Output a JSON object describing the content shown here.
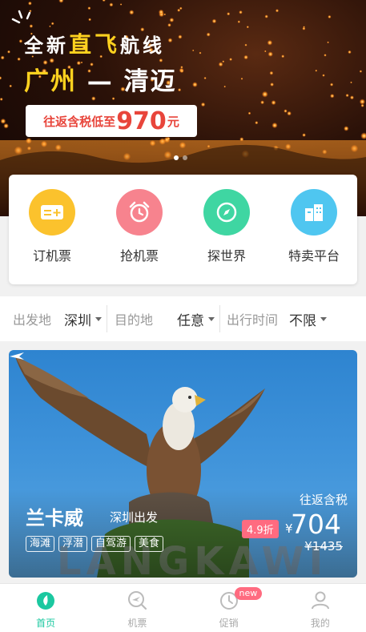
{
  "banner": {
    "line1_a": "全新",
    "line1_b": "直飞",
    "line1_c": "航线",
    "route_from": "广州",
    "route_dash": "—",
    "route_to": "清迈",
    "price_prefix": "往返含税低至",
    "price_value": "970",
    "price_unit": "元",
    "carousel_pages": 2,
    "carousel_active": 1
  },
  "quick_menu": [
    {
      "label": "订机票",
      "icon": "ticket-icon",
      "color": "#fbc22d"
    },
    {
      "label": "抢机票",
      "icon": "alarm-clock-icon",
      "color": "#f7838e"
    },
    {
      "label": "探世界",
      "icon": "compass-icon",
      "color": "#3fd6a2"
    },
    {
      "label": "特卖平台",
      "icon": "store-icon",
      "color": "#4fc6f0"
    }
  ],
  "filter": {
    "origin_label": "出发地",
    "origin_value": "深圳",
    "destination_label": "目的地",
    "destination_value": "任意",
    "time_label": "出行时间",
    "time_value": "不限"
  },
  "deal": {
    "destination": "兰卡威",
    "departure": "深圳出发",
    "tags": [
      "海滩",
      "浮潜",
      "自驾游",
      "美食"
    ],
    "roundtrip_label": "往返含税",
    "discount": "4.9折",
    "currency": "¥",
    "price": "704",
    "original_price": "¥1435",
    "sign_text": "LANGKAWI"
  },
  "tabs": [
    {
      "label": "首页",
      "icon": "home-icon",
      "active": true
    },
    {
      "label": "机票",
      "icon": "flight-search-icon",
      "active": false
    },
    {
      "label": "促销",
      "icon": "promotion-icon",
      "active": false,
      "badge": "new"
    },
    {
      "label": "我的",
      "icon": "profile-icon",
      "active": false
    }
  ],
  "colors": {
    "accent": "#1bc8a0",
    "price_red": "#e8453b",
    "banner_yellow": "#ffd21f",
    "discount_pink": "#ff6b80"
  }
}
